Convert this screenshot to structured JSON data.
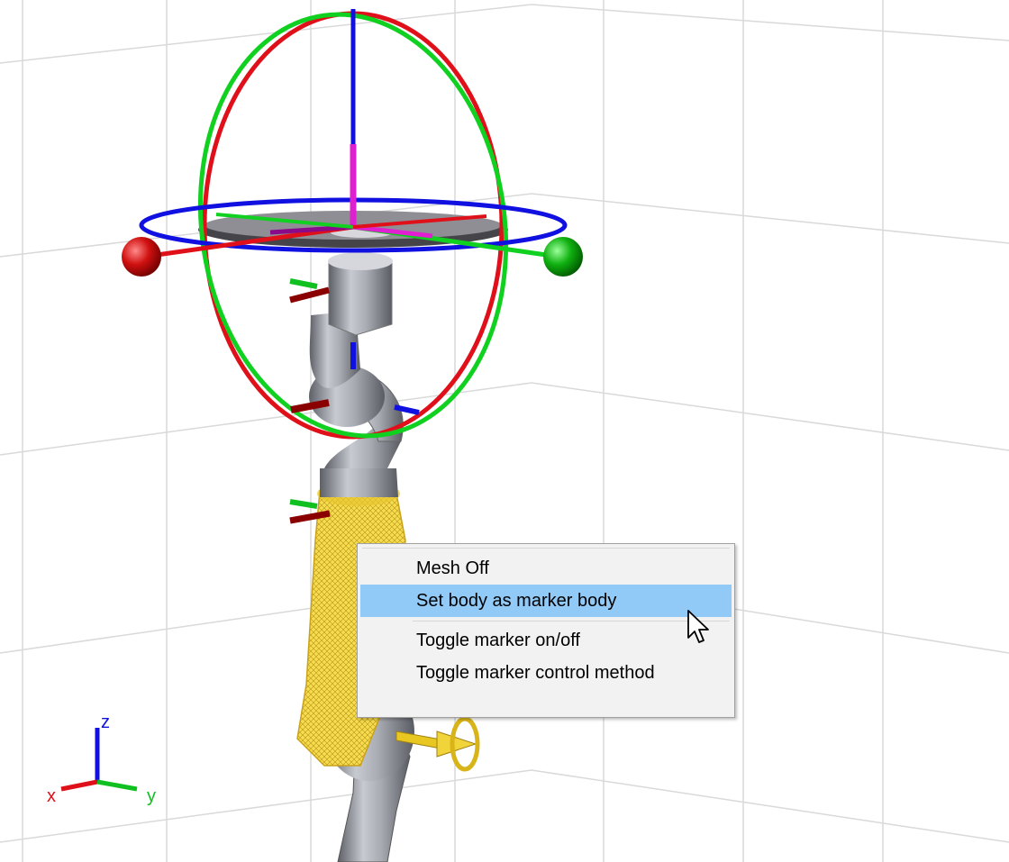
{
  "context_menu": {
    "items": [
      {
        "label": "Mesh Off",
        "highlighted": false
      },
      {
        "label": "Set body as marker body",
        "highlighted": true
      },
      {
        "label": "Toggle marker on/off",
        "highlighted": false
      },
      {
        "label": "Toggle marker control method",
        "highlighted": false
      }
    ]
  },
  "axes_triad": {
    "x_label": "x",
    "y_label": "y",
    "z_label": "z"
  },
  "colors": {
    "x_axis": "#e0101a",
    "y_axis": "#10c020",
    "z_axis": "#1010e0",
    "robot_body": "#a7a9b2",
    "mesh_highlight": "#f5d63a",
    "menu_highlight": "#91c9f7",
    "grid": "#d9d9d9"
  },
  "icons": [
    "mouse-pointer-icon",
    "axes-triad-icon",
    "rotation-gizmo-icon",
    "translation-marker-icon"
  ]
}
